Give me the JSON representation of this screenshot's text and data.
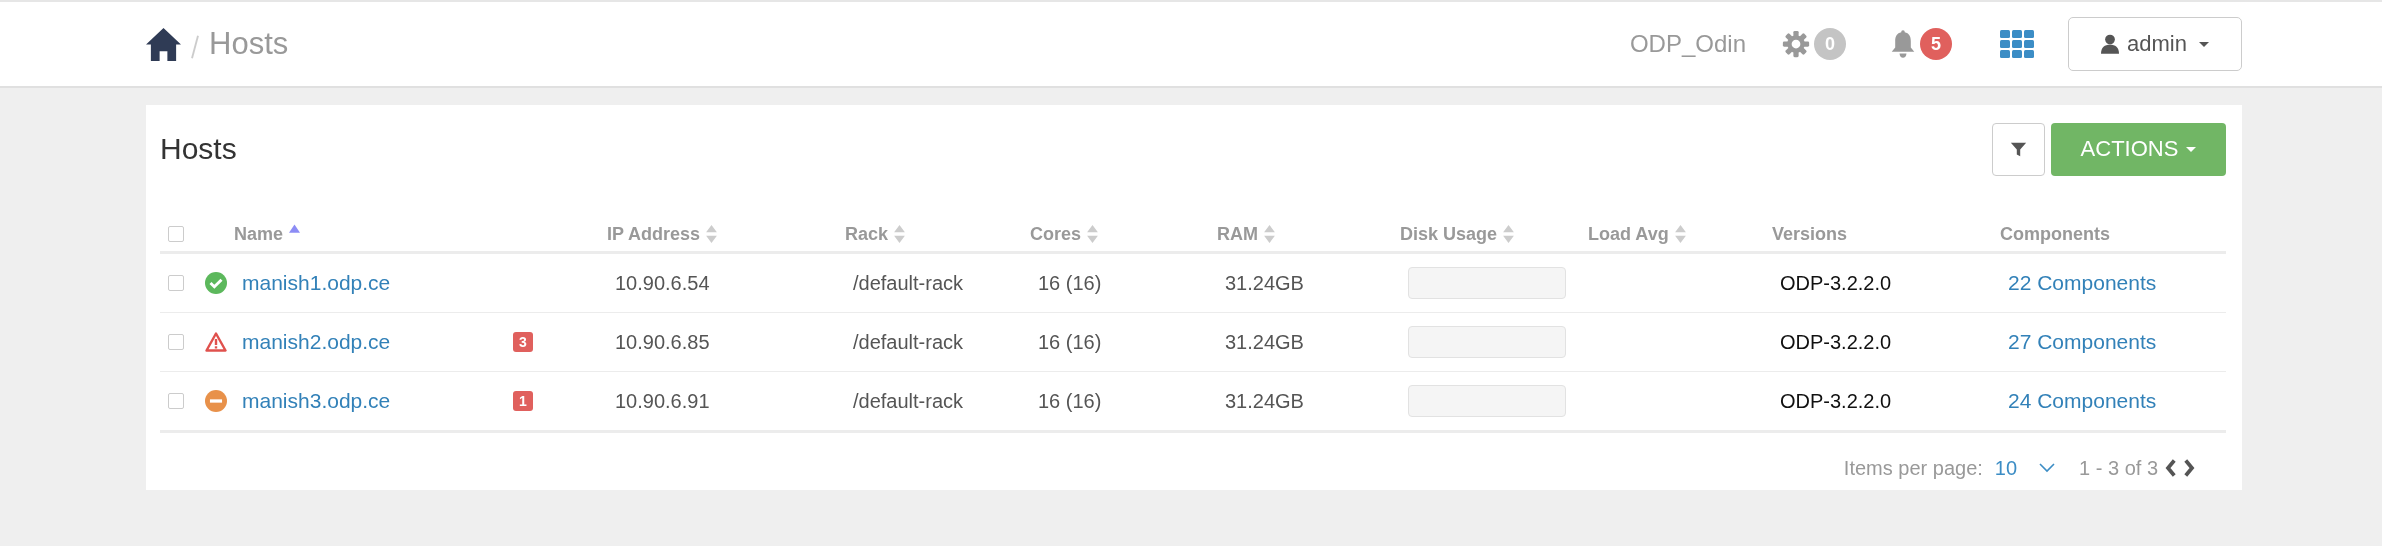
{
  "breadcrumb": {
    "current": "Hosts"
  },
  "topbar": {
    "cluster": "ODP_Odin",
    "ops_count": "0",
    "alerts_count": "5",
    "user": "admin"
  },
  "panel": {
    "title": "Hosts",
    "actions_label": "ACTIONS"
  },
  "table": {
    "select_all_checked": false,
    "columns": [
      {
        "label": "Name",
        "kind": "sorted"
      },
      {
        "label": "IP Address",
        "kind": "sortable"
      },
      {
        "label": "Rack",
        "kind": "sortable"
      },
      {
        "label": "Cores",
        "kind": "sortable"
      },
      {
        "label": "RAM",
        "kind": "sortable"
      },
      {
        "label": "Disk Usage",
        "kind": "sortable"
      },
      {
        "label": "Load Avg",
        "kind": "sortable"
      },
      {
        "label": "Versions",
        "kind": "plain"
      },
      {
        "label": "Components",
        "kind": "plain"
      }
    ],
    "rows": [
      {
        "checked": false,
        "kind": "healthy",
        "name": "manish1.odp.ce",
        "ip": "10.90.6.54",
        "rack": "/default-rack",
        "cores": "16 (16)",
        "ram": "31.24GB",
        "version": "ODP-3.2.2.0",
        "components": "22 Components"
      },
      {
        "checked": false,
        "kind": "alert",
        "name": "manish2.odp.ce",
        "alerts": "3",
        "ip": "10.90.6.85",
        "rack": "/default-rack",
        "cores": "16 (16)",
        "ram": "31.24GB",
        "version": "ODP-3.2.2.0",
        "components": "27 Components"
      },
      {
        "checked": false,
        "kind": "warning",
        "name": "manish3.odp.ce",
        "alerts": "1",
        "ip": "10.90.6.91",
        "rack": "/default-rack",
        "cores": "16 (16)",
        "ram": "31.24GB",
        "version": "ODP-3.2.2.0",
        "components": "24 Components"
      }
    ]
  },
  "footer": {
    "items_per_page_label": "Items per page:",
    "page_size": "10",
    "range": "1 - 3 of 3"
  }
}
